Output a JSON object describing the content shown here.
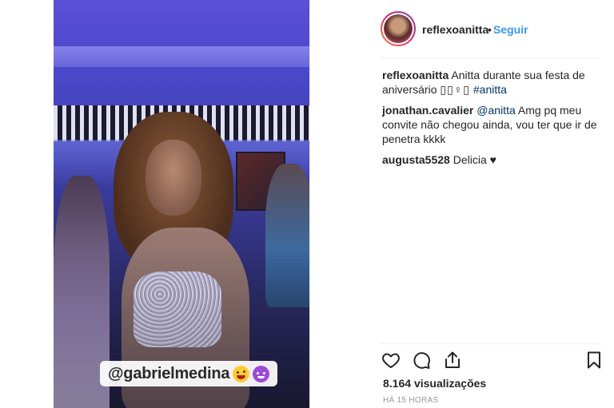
{
  "post": {
    "media": {
      "overlay_mention": "@gabrielmedina",
      "overlay_emojis": [
        "grinning-tongue-emoji",
        "devil-emoji"
      ]
    },
    "header": {
      "username": "reflexoanitta",
      "separator": "•",
      "follow_label": "Seguir"
    },
    "caption": {
      "username": "reflexoanitta",
      "text": "Anitta durante sua festa de aniversário ",
      "emoji_glyphs": "▯▯♀▯",
      "hashtag": "#anitta"
    },
    "comments": [
      {
        "username": "jonathan.cavalier",
        "mention": "@anitta",
        "text": " Amg pq meu convite não chegou ainda, vou ter que ir de penetra kkkk"
      },
      {
        "username": "augusta5528",
        "text": " Delicia ♥"
      }
    ],
    "actions": {
      "like_icon": "heart-outline-icon",
      "comment_icon": "speech-bubble-icon",
      "share_icon": "share-upload-icon",
      "save_icon": "bookmark-icon"
    },
    "views_count": "8.164",
    "views_label": "visualizações",
    "timestamp": "HÁ 15 HORAS"
  },
  "colors": {
    "link_blue": "#3897f0",
    "mention_blue": "#003569",
    "text_primary": "#262626",
    "text_muted": "#999999"
  }
}
